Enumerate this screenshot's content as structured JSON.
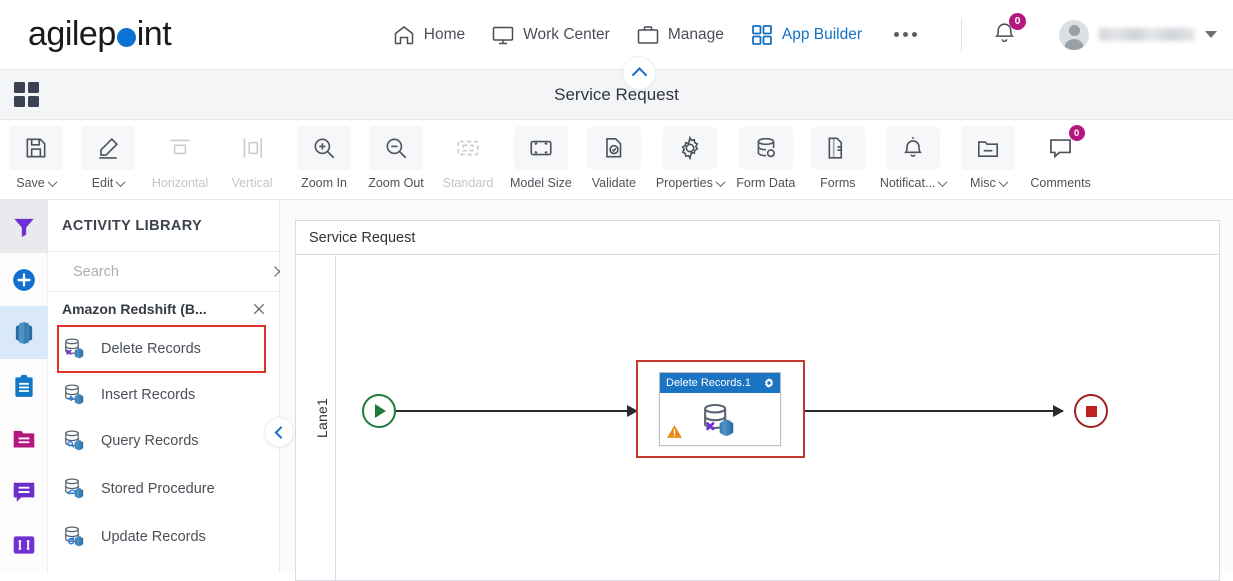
{
  "brand": {
    "name_part1": "agilep",
    "name_part2": "int",
    "dot_color": "#0c72d4"
  },
  "topnav": {
    "items": [
      {
        "label": "Home",
        "icon": "home-icon",
        "active": false
      },
      {
        "label": "Work Center",
        "icon": "monitor-icon",
        "active": false
      },
      {
        "label": "Manage",
        "icon": "briefcase-icon",
        "active": false
      },
      {
        "label": "App Builder",
        "icon": "grid-icon",
        "active": true
      }
    ],
    "more_label": "",
    "notification_count": "0",
    "user_name": ""
  },
  "appbar": {
    "title": "Service Request",
    "grid_icon": "app-grid-icon"
  },
  "toolbar": {
    "items": [
      {
        "label": "Save",
        "icon": "save-icon",
        "dropdown": true,
        "disabled": false,
        "badge": ""
      },
      {
        "label": "Edit",
        "icon": "pencil-icon",
        "dropdown": true,
        "disabled": false,
        "badge": ""
      },
      {
        "label": "Horizontal",
        "icon": "align-horizontal-icon",
        "dropdown": false,
        "disabled": true,
        "badge": ""
      },
      {
        "label": "Vertical",
        "icon": "align-vertical-icon",
        "dropdown": false,
        "disabled": true,
        "badge": ""
      },
      {
        "label": "Zoom In",
        "icon": "zoom-in-icon",
        "dropdown": false,
        "disabled": false,
        "badge": ""
      },
      {
        "label": "Zoom Out",
        "icon": "zoom-out-icon",
        "dropdown": false,
        "disabled": false,
        "badge": ""
      },
      {
        "label": "Standard",
        "icon": "fit-standard-icon",
        "dropdown": false,
        "disabled": true,
        "badge": ""
      },
      {
        "label": "Model Size",
        "icon": "model-size-icon",
        "dropdown": false,
        "disabled": false,
        "badge": ""
      },
      {
        "label": "Validate",
        "icon": "validate-icon",
        "dropdown": false,
        "disabled": false,
        "badge": ""
      },
      {
        "label": "Properties",
        "icon": "gear-icon",
        "dropdown": true,
        "disabled": false,
        "badge": ""
      },
      {
        "label": "Form Data",
        "icon": "form-data-icon",
        "dropdown": false,
        "disabled": false,
        "badge": ""
      },
      {
        "label": "Forms",
        "icon": "forms-icon",
        "dropdown": false,
        "disabled": false,
        "badge": ""
      },
      {
        "label": "Notificat...",
        "icon": "bell-icon",
        "dropdown": true,
        "disabled": false,
        "badge": ""
      },
      {
        "label": "Misc",
        "icon": "folder-misc-icon",
        "dropdown": true,
        "disabled": false,
        "badge": ""
      },
      {
        "label": "Comments",
        "icon": "comment-icon",
        "dropdown": false,
        "disabled": false,
        "badge": "0"
      }
    ]
  },
  "rail": {
    "items": [
      {
        "name": "filter-icon",
        "state": "selected-grey"
      },
      {
        "name": "add-icon",
        "state": "none"
      },
      {
        "name": "redshift-icon",
        "state": "selected-blue"
      },
      {
        "name": "clipboard-icon",
        "state": "none"
      },
      {
        "name": "folder-icon",
        "state": "none"
      },
      {
        "name": "chat-icon",
        "state": "none"
      },
      {
        "name": "columns-icon",
        "state": "none"
      }
    ]
  },
  "panel": {
    "title": "ACTIVITY LIBRARY",
    "search": {
      "value": "",
      "placeholder": "Search"
    },
    "group": {
      "label": "Amazon Redshift (B..."
    },
    "items": [
      {
        "label": "Delete Records",
        "icon": "db-delete-icon",
        "highlighted": true
      },
      {
        "label": "Insert Records",
        "icon": "db-insert-icon",
        "highlighted": false
      },
      {
        "label": "Query Records",
        "icon": "db-query-icon",
        "highlighted": false
      },
      {
        "label": "Stored Procedure",
        "icon": "db-stored-procedure-icon",
        "highlighted": false
      },
      {
        "label": "Update Records",
        "icon": "db-update-icon",
        "highlighted": false
      }
    ]
  },
  "canvas": {
    "pool_title": "Service Request",
    "lane_label": "Lane1",
    "activity": {
      "title": "Delete Records.1",
      "icon": "db-delete-icon",
      "warning": true,
      "selected": true
    },
    "start_event": "start-event",
    "end_event": "end-event"
  },
  "colors": {
    "accent_blue": "#1570c4",
    "badge_magenta": "#b5177e",
    "selection_red": "#c0392b",
    "node_header_blue": "#1a74c2",
    "start_green": "#1f7a3d",
    "end_red": "#9e2020",
    "warning_orange": "#e8891a"
  }
}
